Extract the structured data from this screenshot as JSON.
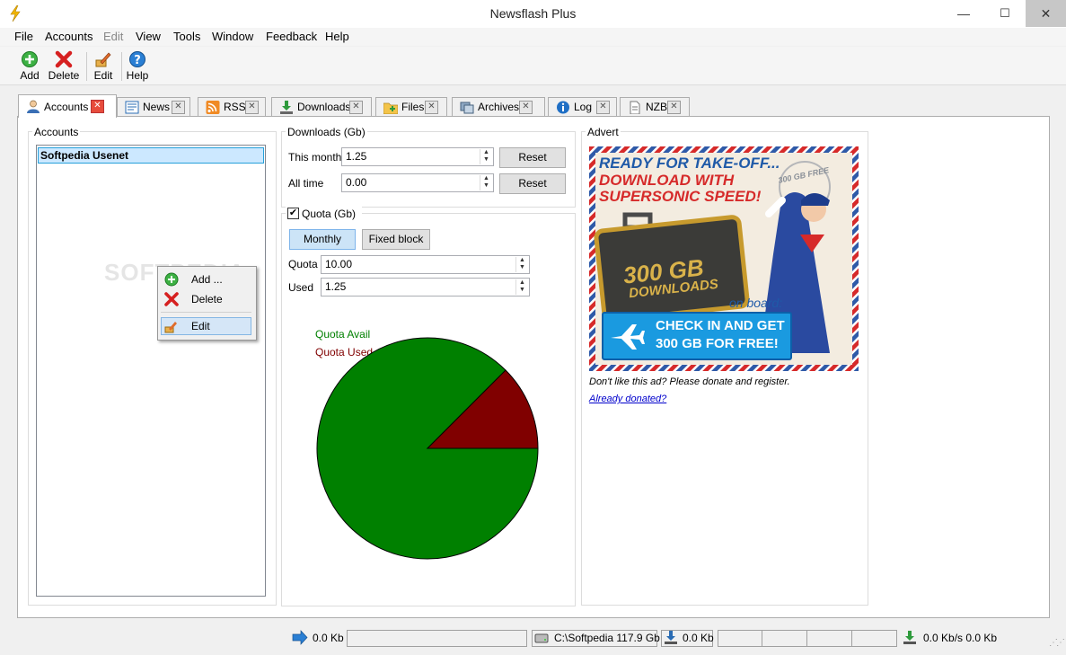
{
  "window": {
    "title": "Newsflash Plus",
    "minimize_glyph": "—",
    "maximize_glyph": "☐",
    "close_glyph": "✕"
  },
  "menu": [
    "File",
    "Accounts",
    "Edit",
    "View",
    "Tools",
    "Window",
    "Feedback",
    "Help"
  ],
  "toolbar": {
    "add": "Add",
    "delete": "Delete",
    "edit": "Edit",
    "help": "Help"
  },
  "tabs": [
    {
      "label": "Accounts",
      "icon": "user-icon"
    },
    {
      "label": "News",
      "icon": "news-icon"
    },
    {
      "label": "RSS",
      "icon": "rss-icon"
    },
    {
      "label": "Downloads",
      "icon": "download-icon"
    },
    {
      "label": "Files",
      "icon": "folder-icon"
    },
    {
      "label": "Archives",
      "icon": "archive-icon"
    },
    {
      "label": "Log",
      "icon": "info-icon"
    },
    {
      "label": "NZB",
      "icon": "nzb-icon"
    }
  ],
  "accounts": {
    "group_label": "Accounts",
    "items": [
      "Softpedia Usenet"
    ]
  },
  "downloads": {
    "group_label": "Downloads (Gb)",
    "this_month_label": "This month",
    "this_month_value": "1.25",
    "all_time_label": "All time",
    "all_time_value": "0.00",
    "reset_label": "Reset"
  },
  "quota": {
    "group_label": "Quota (Gb)",
    "enabled": true,
    "monthly_label": "Monthly",
    "fixed_label": "Fixed block",
    "quota_label": "Quota",
    "quota_value": "10.00",
    "used_label": "Used",
    "used_value": "1.25"
  },
  "chart_data": {
    "type": "pie",
    "labels": [
      "Quota Avail",
      "Quota Used"
    ],
    "values": [
      8.75,
      1.25
    ],
    "colors": [
      "#008000",
      "#800000"
    ],
    "legend_placement": "top-left"
  },
  "advert": {
    "group_label": "Advert",
    "line1": "READY FOR TAKE-OFF...",
    "line2": "DOWNLOAD WITH",
    "line3": "SUPERSONIC SPEED!",
    "case_line1": "300 GB",
    "case_line2": "DOWNLOADS",
    "on_board": "on board:",
    "cta_line1": "CHECK IN AND GET",
    "cta_line2": "300 GB FOR FREE!",
    "stamp": "300 GB FREE",
    "note": "Don't like this ad? Please donate and register.",
    "link": "Already donated?"
  },
  "context_menu": {
    "add": "Add ...",
    "delete": "Delete",
    "edit": "Edit"
  },
  "watermark": "SOFTPEDIA",
  "status": {
    "upload": "0.0 Kb",
    "disk": "C:\\Softpedia 117.9 Gb",
    "download": "0.0 Kb",
    "speed": "0.0 Kb/s 0.0 Kb"
  }
}
